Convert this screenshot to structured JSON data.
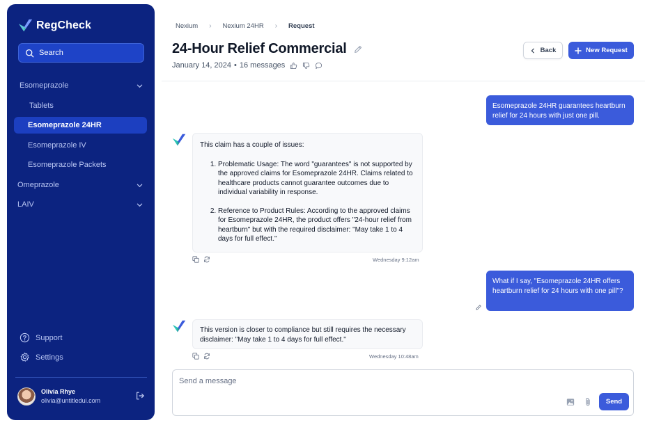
{
  "app": {
    "name": "RegCheck"
  },
  "search": {
    "label": "Search"
  },
  "sidebar": {
    "items": [
      {
        "label": "Esomeprazole",
        "expandable": true
      },
      {
        "label": "Tablets"
      },
      {
        "label": "Esomeprazole 24HR",
        "active": true
      },
      {
        "label": "Esomeprazole IV"
      },
      {
        "label": "Esomeprazole Packets"
      },
      {
        "label": "Omeprazole",
        "expandable": true
      },
      {
        "label": "LAIV",
        "expandable": true
      }
    ],
    "bottom": {
      "support": "Support",
      "settings": "Settings"
    },
    "user": {
      "name": "Olivia Rhye",
      "email": "olivia@untitledui.com"
    }
  },
  "breadcrumb": [
    "Nexium",
    "Nexium 24HR",
    "Request"
  ],
  "header": {
    "title": "24-Hour Relief Commercial",
    "date": "January 14, 2024",
    "separator": "•",
    "messages": "16 messages",
    "back_label": "Back",
    "new_request_label": "New Request"
  },
  "chat": {
    "user_msg_1": "Esomeprazole 24HR guarantees heartburn relief for 24 hours with just one pill.",
    "bot_msg_1": {
      "intro": "This claim has a couple of issues:",
      "points": [
        "Problematic Usage: The word \"guarantees\" is not supported by the approved claims for Esomeprazole 24HR. Claims related to healthcare products cannot guarantee outcomes due to individual variability in response.",
        "Reference to Product Rules: According to the approved claims for Esomeprazole 24HR, the product offers \"24-hour relief from heartburn\" but with the required disclaimer: \"May take 1 to 4 days for full effect.\""
      ],
      "time": "Wednesday 9:12am"
    },
    "user_msg_2": "What if I say, \"Esomeprazole 24HR offers heartburn relief for 24 hours with one pill\"?",
    "bot_msg_2": {
      "text": "This version is closer to compliance but still requires the necessary disclaimer: \"May take 1 to 4 days for full effect.\"",
      "time": "Wednesday 10:48am"
    }
  },
  "composer": {
    "placeholder": "Send a message",
    "send_label": "Send"
  },
  "colors": {
    "sidebar_bg": "#0c2380",
    "accent": "#3b5bdb",
    "active_item": "#1c3fc0"
  },
  "icons": [
    "logo-check-icon",
    "search-icon",
    "chevron-down-icon",
    "help-circle-icon",
    "settings-icon",
    "logout-icon",
    "pencil-icon",
    "thumbs-up-icon",
    "thumbs-down-icon",
    "comment-icon",
    "chevron-left-icon",
    "plus-icon",
    "copy-icon",
    "refresh-icon",
    "image-icon",
    "paperclip-icon"
  ]
}
